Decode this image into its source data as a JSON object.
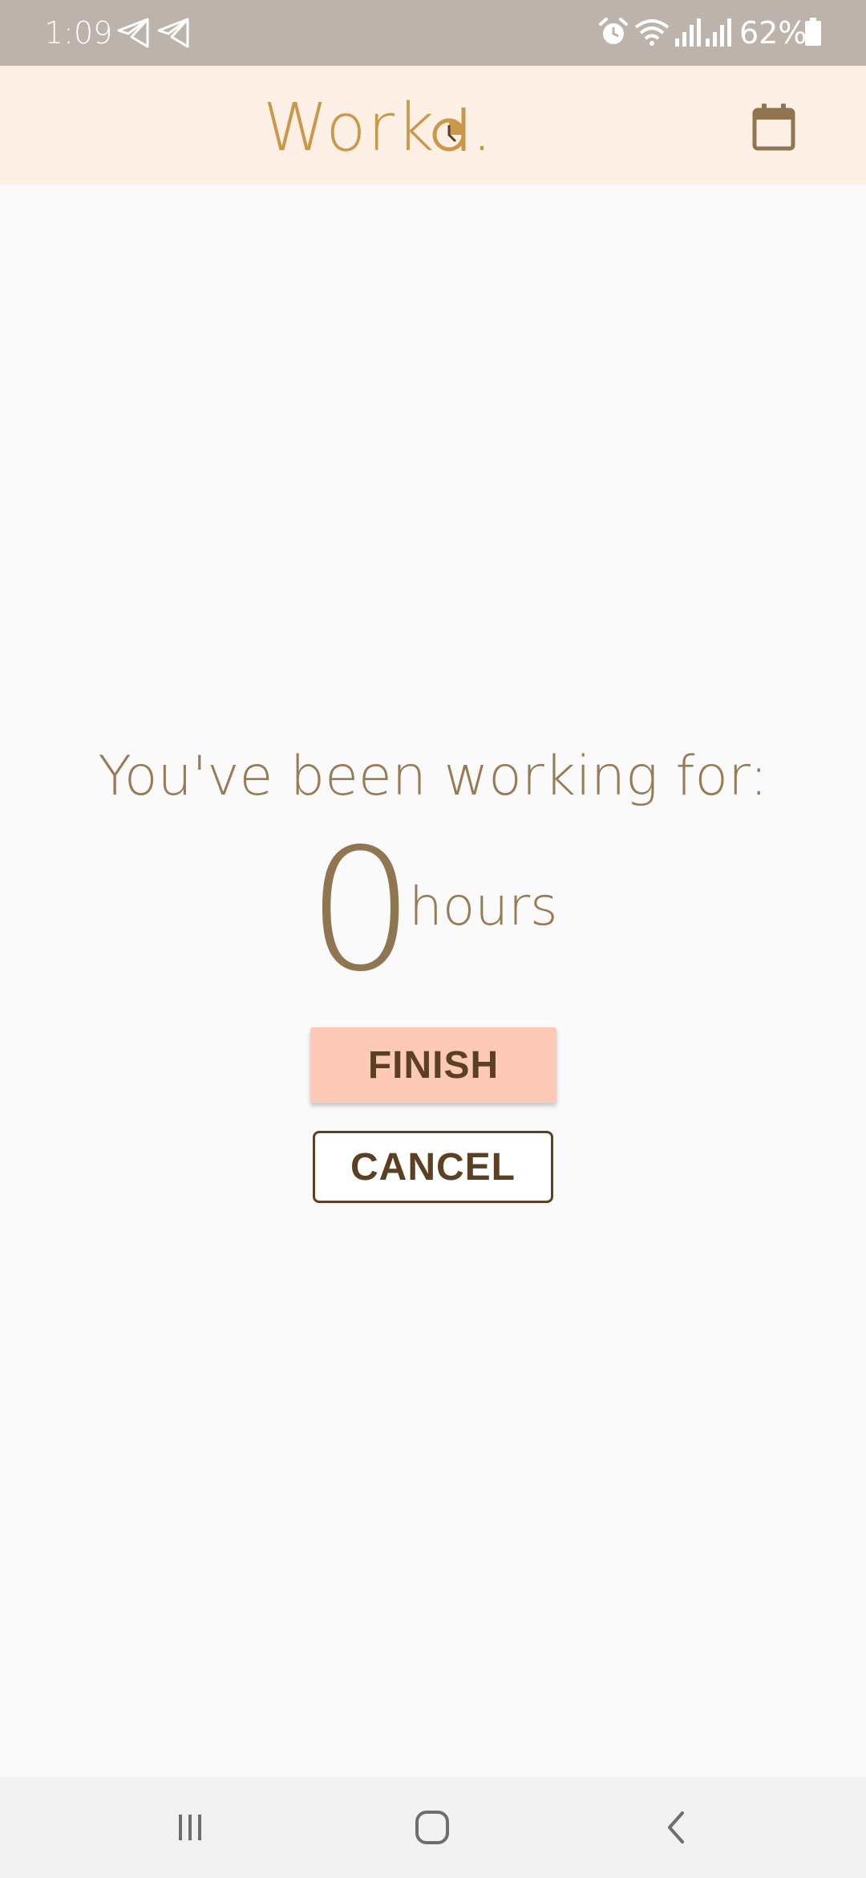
{
  "status_bar": {
    "time": "1:09",
    "battery_percent": "62%",
    "icons": [
      "send-icon",
      "send-icon",
      "alarm-icon",
      "wifi-icon",
      "signal-icon",
      "signal-icon",
      "battery-icon"
    ]
  },
  "app_bar": {
    "logo_text": "Work",
    "logo_suffix": ".",
    "logo_mark_icon": "clock-d-icon",
    "calendar_icon": "calendar-icon"
  },
  "main": {
    "label": "You've been working for:",
    "hours_value": "0",
    "hours_unit": "hours",
    "finish_label": "FINISH",
    "cancel_label": "CANCEL"
  },
  "nav_bar": {
    "icons": [
      "recents-icon",
      "home-icon",
      "back-icon"
    ]
  },
  "colors": {
    "status_bar": "#beb3aa",
    "app_bar": "#fff0e6",
    "logo": "#c9984a",
    "text_brown": "#967b55",
    "finish_bg": "#ffc9b8",
    "button_text": "#5b4122",
    "background": "#fafafa",
    "nav_bar": "#f2f2f2"
  }
}
